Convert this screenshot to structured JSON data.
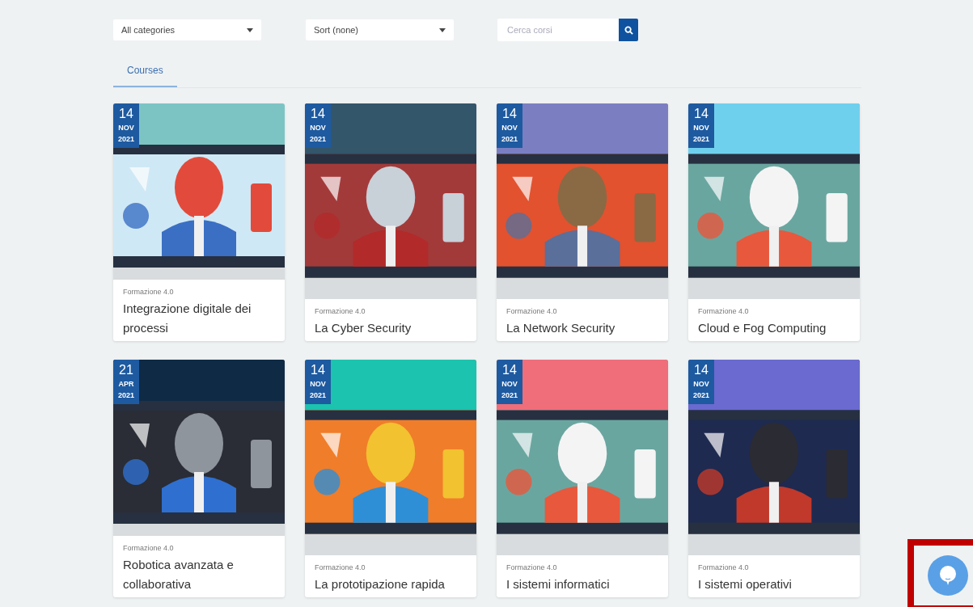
{
  "filters": {
    "category": {
      "value": "All categories"
    },
    "sort": {
      "value": "Sort (none)"
    },
    "search": {
      "placeholder": "Cerca corsi"
    }
  },
  "tabs": [
    {
      "label": "Courses",
      "selected": true
    }
  ],
  "courses": [
    {
      "day": "14",
      "month": "NOV",
      "year": "2021",
      "category": "Formazione 4.0",
      "title": "Integrazione digitale dei processi"
    },
    {
      "day": "14",
      "month": "NOV",
      "year": "2021",
      "category": "Formazione 4.0",
      "title": "La Cyber Security"
    },
    {
      "day": "14",
      "month": "NOV",
      "year": "2021",
      "category": "Formazione 4.0",
      "title": "La Network Security"
    },
    {
      "day": "14",
      "month": "NOV",
      "year": "2021",
      "category": "Formazione 4.0",
      "title": "Cloud e Fog Computing"
    },
    {
      "day": "21",
      "month": "APR",
      "year": "2021",
      "category": "Formazione 4.0",
      "title": "Robotica avanzata e collaborativa"
    },
    {
      "day": "14",
      "month": "NOV",
      "year": "2021",
      "category": "Formazione 4.0",
      "title": "La prototipazione rapida"
    },
    {
      "day": "14",
      "month": "NOV",
      "year": "2021",
      "category": "Formazione 4.0",
      "title": "I sistemi informatici"
    },
    {
      "day": "14",
      "month": "NOV",
      "year": "2021",
      "category": "Formazione 4.0",
      "title": "I sistemi operativi"
    }
  ],
  "chat_button": {
    "highlighted": true
  }
}
